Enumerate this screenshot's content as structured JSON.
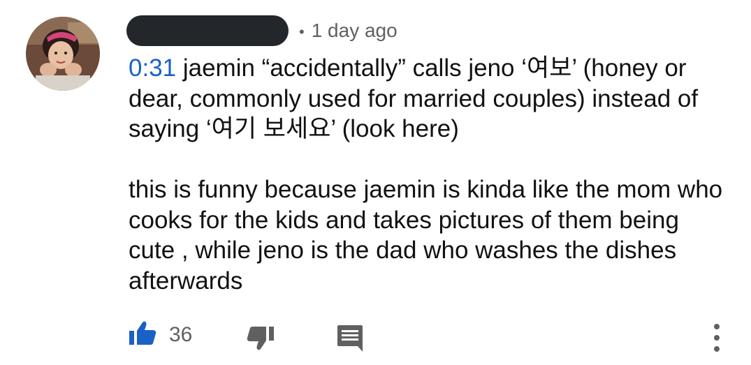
{
  "comment": {
    "author_name_hidden": true,
    "age": "1 day ago",
    "separator": "•",
    "timestamp_link": "0:31",
    "line1_rest": " jaemin “accidentally” calls jeno ‘여보’ (honey or dear, commonly used for married couples) instead of saying ‘여기 보세요’ (look here)",
    "paragraph2": "this is funny because jaemin is kinda like the mom who cooks for the kids and takes pictures of them being cute , while jeno is the dad who washes the dishes afterwards"
  },
  "actions": {
    "like_count": "36",
    "like_icon": "thumbs-up-filled-icon",
    "dislike_icon": "thumbs-down-icon",
    "reply_icon": "comment-reply-icon",
    "more_icon": "more-vertical-icon"
  },
  "colors": {
    "link": "#1a61c6",
    "like_active": "#1a61c6",
    "icon_gray": "#606060",
    "redaction": "#23272b"
  }
}
